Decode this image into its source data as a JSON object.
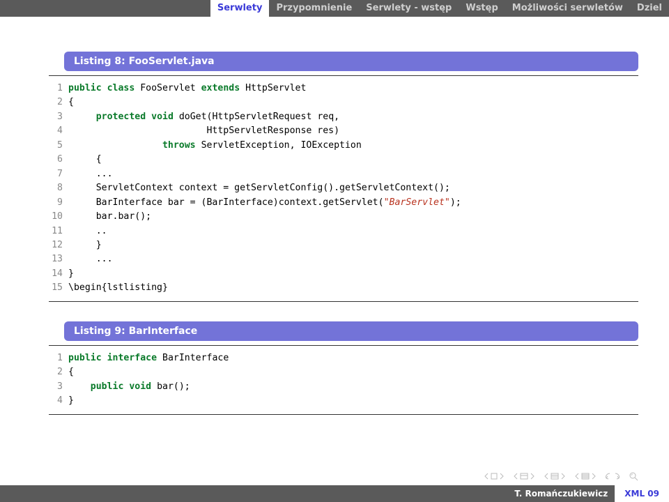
{
  "topbar": {
    "active": "Serwlety",
    "tabs": [
      "Przypomnienie",
      "Serwlety - wstęp",
      "Wstęp",
      "Możliwości serwletów",
      "Dziel"
    ]
  },
  "listing1": {
    "title": "Listing 8: FooServlet.java",
    "lines": [
      {
        "n": "1",
        "seg": [
          {
            "t": "public",
            "c": "kw"
          },
          {
            "t": " ",
            "c": ""
          },
          {
            "t": "class",
            "c": "kw"
          },
          {
            "t": " FooServlet ",
            "c": ""
          },
          {
            "t": "extends",
            "c": "kw"
          },
          {
            "t": " HttpServlet",
            "c": ""
          }
        ]
      },
      {
        "n": "2",
        "seg": [
          {
            "t": "{",
            "c": ""
          }
        ]
      },
      {
        "n": "3",
        "seg": [
          {
            "t": "     ",
            "c": ""
          },
          {
            "t": "protected",
            "c": "kw"
          },
          {
            "t": " ",
            "c": ""
          },
          {
            "t": "void",
            "c": "kw"
          },
          {
            "t": " doGet(HttpServletRequest req,",
            "c": ""
          }
        ]
      },
      {
        "n": "4",
        "seg": [
          {
            "t": "                         HttpServletResponse res)",
            "c": ""
          }
        ]
      },
      {
        "n": "5",
        "seg": [
          {
            "t": "                 ",
            "c": ""
          },
          {
            "t": "throws",
            "c": "kw"
          },
          {
            "t": " ServletException, IOException",
            "c": ""
          }
        ]
      },
      {
        "n": "6",
        "seg": [
          {
            "t": "     {",
            "c": ""
          }
        ]
      },
      {
        "n": "7",
        "seg": [
          {
            "t": "     ...",
            "c": ""
          }
        ]
      },
      {
        "n": "8",
        "seg": [
          {
            "t": "     ServletContext context = getServletConfig().getServletContext();",
            "c": ""
          }
        ]
      },
      {
        "n": "9",
        "seg": [
          {
            "t": "     BarInterface bar = (BarInterface)context.getServlet(",
            "c": ""
          },
          {
            "t": "\"BarServlet\"",
            "c": "str"
          },
          {
            "t": ");",
            "c": ""
          }
        ]
      },
      {
        "n": "10",
        "seg": [
          {
            "t": "     bar.bar();",
            "c": ""
          }
        ]
      },
      {
        "n": "11",
        "seg": [
          {
            "t": "     ..",
            "c": ""
          }
        ]
      },
      {
        "n": "12",
        "seg": [
          {
            "t": "     }",
            "c": ""
          }
        ]
      },
      {
        "n": "13",
        "seg": [
          {
            "t": "     ...",
            "c": ""
          }
        ]
      },
      {
        "n": "14",
        "seg": [
          {
            "t": "}",
            "c": ""
          }
        ]
      },
      {
        "n": "15",
        "seg": [
          {
            "t": "\\begin{lstlisting}",
            "c": ""
          }
        ]
      }
    ]
  },
  "listing2": {
    "title": "Listing 9: BarInterface",
    "lines": [
      {
        "n": "1",
        "seg": [
          {
            "t": "public",
            "c": "kw"
          },
          {
            "t": " ",
            "c": ""
          },
          {
            "t": "interface",
            "c": "kw"
          },
          {
            "t": " BarInterface",
            "c": ""
          }
        ]
      },
      {
        "n": "2",
        "seg": [
          {
            "t": "{",
            "c": ""
          }
        ]
      },
      {
        "n": "3",
        "seg": [
          {
            "t": "    ",
            "c": ""
          },
          {
            "t": "public",
            "c": "kw"
          },
          {
            "t": " ",
            "c": ""
          },
          {
            "t": "void",
            "c": "kw"
          },
          {
            "t": " bar();",
            "c": ""
          }
        ]
      },
      {
        "n": "4",
        "seg": [
          {
            "t": "}",
            "c": ""
          }
        ]
      }
    ]
  },
  "footer": {
    "author": "T. Romańczukiewicz",
    "course": "XML 09"
  }
}
